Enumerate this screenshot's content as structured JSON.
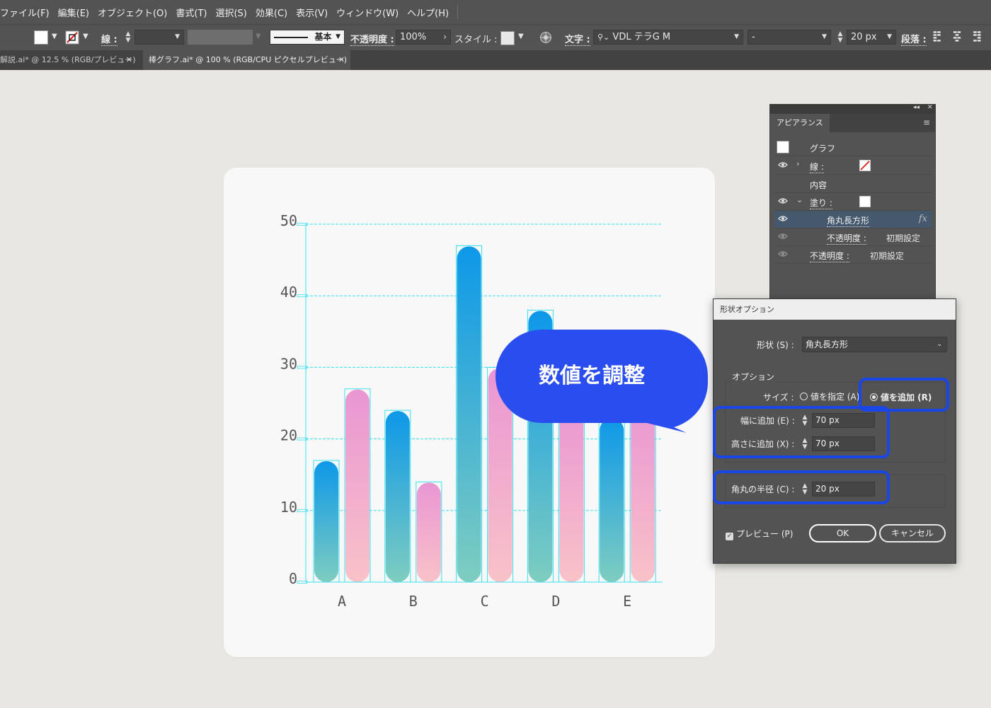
{
  "menu": [
    "ファイル(F)",
    "編集(E)",
    "オブジェクト(O)",
    "書式(T)",
    "選択(S)",
    "効果(C)",
    "表示(V)",
    "ウィンドウ(W)",
    "ヘルプ(H)"
  ],
  "control_bar": {
    "stroke_label": "線 :",
    "stroke_style": "基本",
    "opacity_label": "不透明度 :",
    "opacity_value": "100%",
    "style_label": "スタイル :",
    "char_label": "文字 :",
    "font_name": "VDL テラG M",
    "font_style": "-",
    "font_size": "20 px",
    "paragraph_label": "段落 :"
  },
  "tabs": [
    {
      "label": "解説.ai* @ 12.5 % (RGB/プレビュー)",
      "active": false
    },
    {
      "label": "棒グラフ.ai* @ 100 % (RGB/CPU ピクセルプレビュー)",
      "active": true
    }
  ],
  "chart_data": {
    "type": "bar",
    "categories": [
      "A",
      "B",
      "C",
      "D",
      "E"
    ],
    "series": [
      {
        "values": [
          17,
          24,
          47,
          38,
          23
        ],
        "gradient": [
          "#0d98e8",
          "#7ecdc0"
        ]
      },
      {
        "values": [
          27,
          14,
          30,
          25,
          25
        ],
        "gradient": [
          "#e996d3",
          "#f9c2c8"
        ]
      }
    ],
    "ylim": [
      0,
      50
    ],
    "yticks": [
      "0",
      "10",
      "20",
      "30",
      "40",
      "50"
    ],
    "grid": true
  },
  "appearance_panel": {
    "tab": "アピアランス",
    "rows": [
      {
        "label": "グラフ"
      },
      {
        "label": "線 :"
      },
      {
        "label": "内容"
      },
      {
        "label": "塗り :"
      },
      {
        "label": "角丸長方形",
        "fx": "fx"
      },
      {
        "label": "不透明度 :",
        "value": "初期設定"
      },
      {
        "label": "不透明度 :",
        "value": "初期設定"
      }
    ]
  },
  "shape_dialog": {
    "title": "形状オプション",
    "shape_label": "形状 (S) :",
    "shape_value": "角丸長方形",
    "options_label": "オプション",
    "size_label": "サイズ :",
    "size_absolute": "値を指定 (A)",
    "size_relative": "値を追加 (R)",
    "width_label": "幅に追加 (E) :",
    "width_value": "70 px",
    "height_label": "高さに追加 (X) :",
    "height_value": "70 px",
    "radius_label": "角丸の半径 (C) :",
    "radius_value": "20 px",
    "preview_label": "プレビュー (P)",
    "ok": "OK",
    "cancel": "キャンセル"
  },
  "callout": {
    "text": "数値を調整",
    "color": "#2a4df0"
  },
  "colors": {
    "accent_highlight": "#1a46e8",
    "guide": "#38e0ef"
  }
}
